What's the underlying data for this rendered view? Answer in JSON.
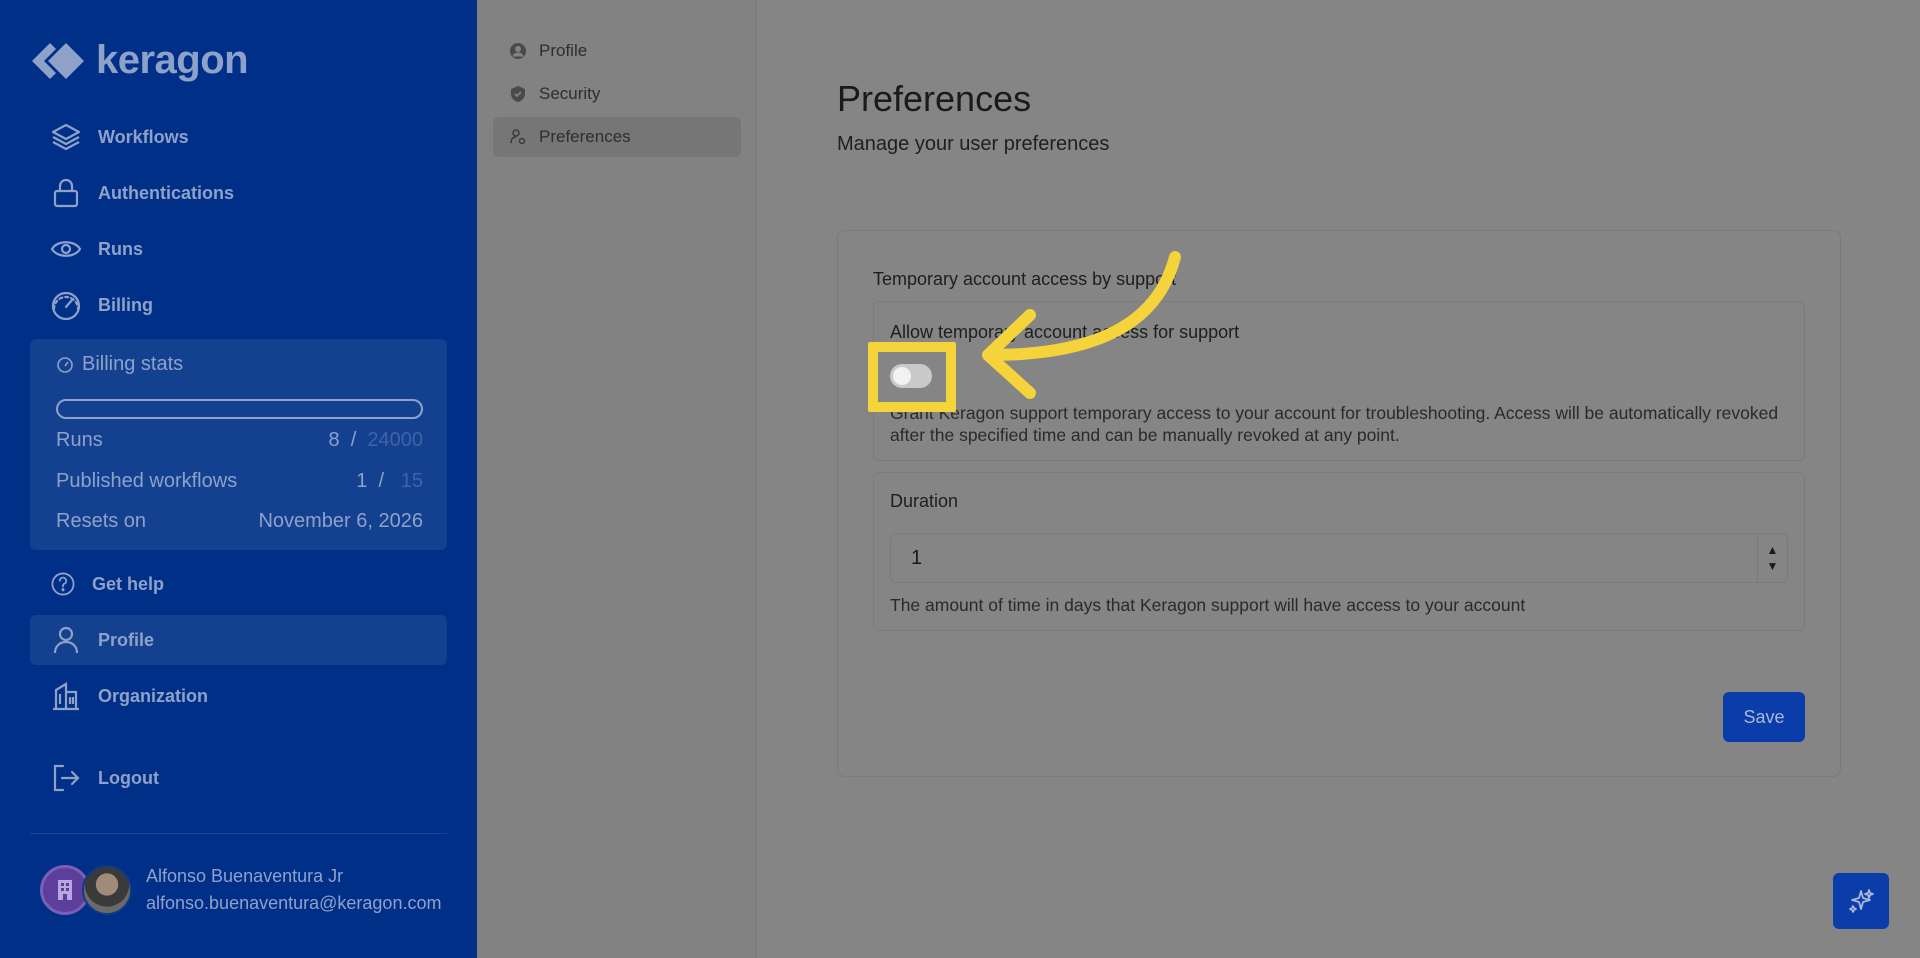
{
  "sidebar": {
    "logo_text": "keragon",
    "nav": [
      {
        "label": "Workflows",
        "icon": "layers-icon"
      },
      {
        "label": "Authentications",
        "icon": "lock-icon"
      },
      {
        "label": "Runs",
        "icon": "eye-icon"
      },
      {
        "label": "Billing",
        "icon": "gauge-icon"
      }
    ],
    "billing_stats": {
      "title": "Billing stats",
      "runs_label": "Runs",
      "runs_used": "8",
      "runs_sep": "/",
      "runs_limit": "24000",
      "runs_progress": 0.0003,
      "published_label": "Published workflows",
      "published_used": "1",
      "published_sep": "/",
      "published_limit": "15",
      "resets_label": "Resets on",
      "resets_value": "November 6, 2026"
    },
    "nav_bottom": [
      {
        "label": "Get help",
        "icon": "help-circle-icon"
      },
      {
        "label": "Profile",
        "icon": "user-icon",
        "active": true
      },
      {
        "label": "Organization",
        "icon": "building-icon"
      },
      {
        "label": "Logout",
        "icon": "logout-icon"
      }
    ],
    "user": {
      "name": "Alfonso Buenaventura Jr",
      "email": "alfonso.buenaventura@keragon.com"
    }
  },
  "subnav": {
    "items": [
      {
        "label": "Profile",
        "icon": "user-circle-icon"
      },
      {
        "label": "Security",
        "icon": "shield-check-icon"
      },
      {
        "label": "Preferences",
        "icon": "user-settings-icon",
        "active": true
      }
    ]
  },
  "main": {
    "title": "Preferences",
    "subtitle": "Manage your user preferences",
    "section_label": "Temporary account access by support",
    "allow_title": "Allow temporary account access for support",
    "allow_toggle_on": false,
    "allow_desc": "Grant Keragon support temporary access to your account for troubleshooting. Access will be automatically revoked after the specified time and can be manually revoked at any point.",
    "duration_label": "Duration",
    "duration_value": "1",
    "duration_help": "The amount of time in days that Keragon support will have access to your account",
    "save_label": "Save"
  },
  "colors": {
    "sidebar_bg": "#002f87",
    "accent": "#0a3caa",
    "highlight": "#f5d33b"
  }
}
